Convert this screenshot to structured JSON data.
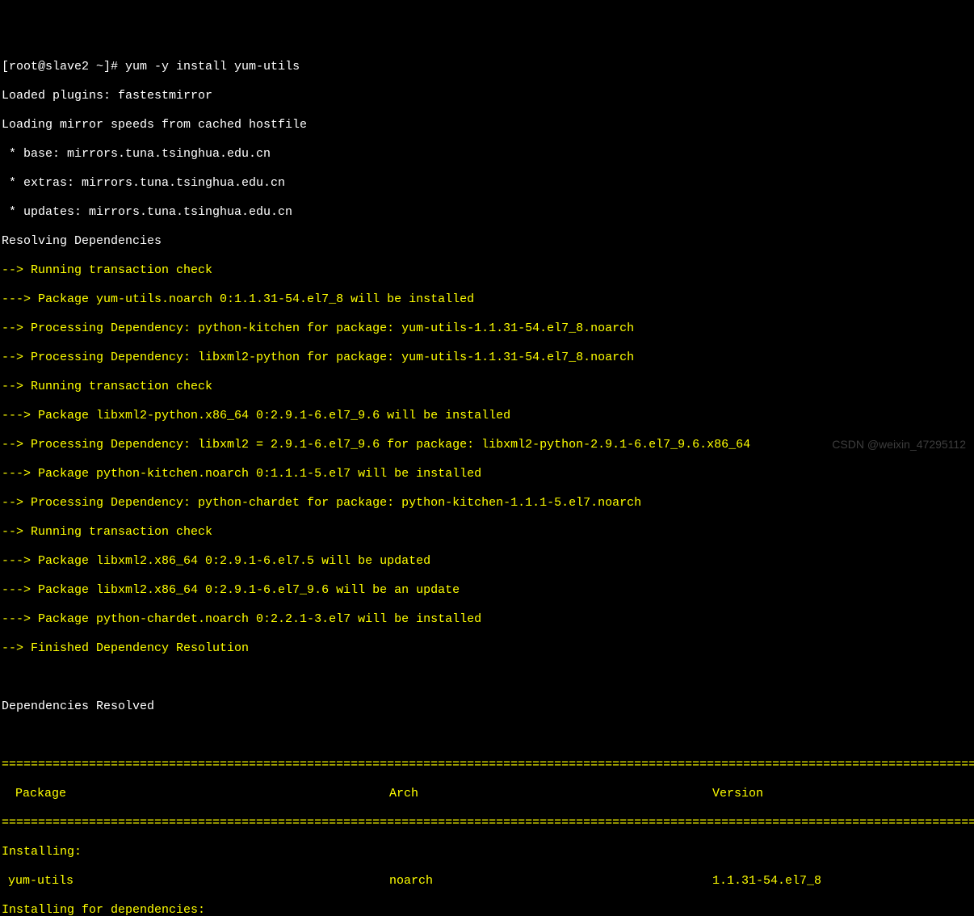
{
  "prompt": {
    "prefix": "[root@slave2 ~]# ",
    "command": "yum -y install yum-utils"
  },
  "output_white": [
    "Loaded plugins: fastestmirror",
    "Loading mirror speeds from cached hostfile",
    " * base: mirrors.tuna.tsinghua.edu.cn",
    " * extras: mirrors.tuna.tsinghua.edu.cn",
    " * updates: mirrors.tuna.tsinghua.edu.cn",
    "Resolving Dependencies"
  ],
  "output_yellow": [
    "--> Running transaction check",
    "---> Package yum-utils.noarch 0:1.1.31-54.el7_8 will be installed",
    "--> Processing Dependency: python-kitchen for package: yum-utils-1.1.31-54.el7_8.noarch",
    "--> Processing Dependency: libxml2-python for package: yum-utils-1.1.31-54.el7_8.noarch",
    "--> Running transaction check",
    "---> Package libxml2-python.x86_64 0:2.9.1-6.el7_9.6 will be installed",
    "--> Processing Dependency: libxml2 = 2.9.1-6.el7_9.6 for package: libxml2-python-2.9.1-6.el7_9.6.x86_64",
    "---> Package python-kitchen.noarch 0:1.1.1-5.el7 will be installed",
    "--> Processing Dependency: python-chardet for package: python-kitchen-1.1.1-5.el7.noarch",
    "--> Running transaction check",
    "---> Package libxml2.x86_64 0:2.9.1-6.el7.5 will be updated",
    "---> Package libxml2.x86_64 0:2.9.1-6.el7_9.6 will be an update",
    "---> Package python-chardet.noarch 0:2.2.1-3.el7 will be installed",
    "--> Finished Dependency Resolution"
  ],
  "deps_resolved": "Dependencies Resolved",
  "divider": "==========================================================================================================================================",
  "table": {
    "headers": {
      "package": " Package",
      "arch": "Arch",
      "version": "Version"
    },
    "sections": {
      "installing": "Installing:",
      "installing_deps": "Installing for dependencies:"
    },
    "rows": [
      {
        "package": "yum-utils",
        "arch": "noarch",
        "version": "1.1.31-54.el7_8"
      }
    ]
  },
  "watermark": "CSDN @weixin_47295112"
}
